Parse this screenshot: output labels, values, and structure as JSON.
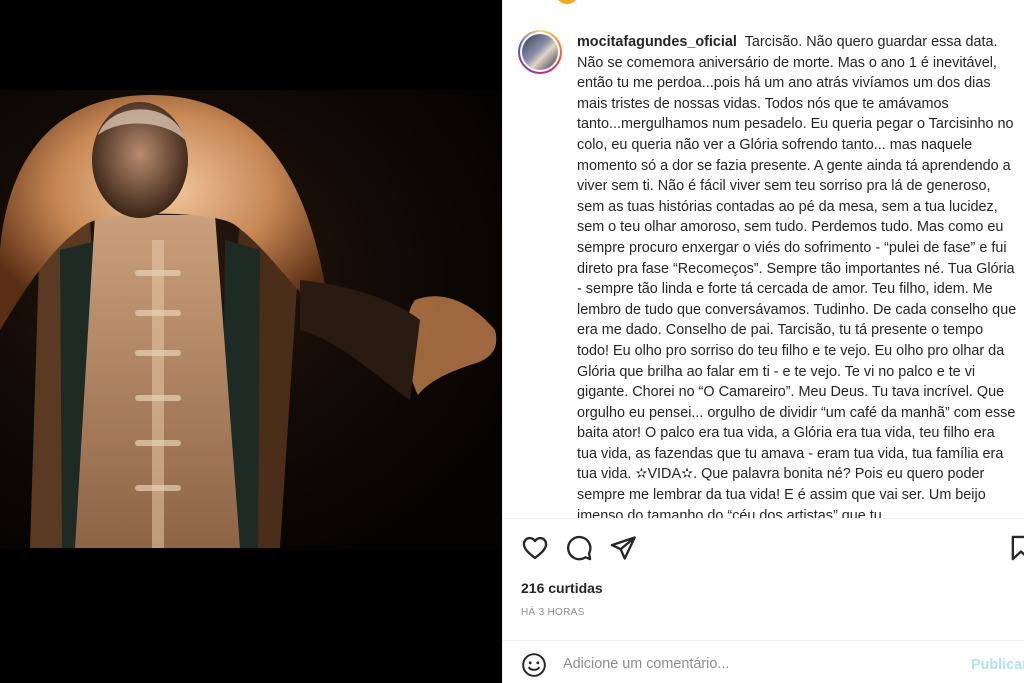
{
  "post": {
    "username": "mocitafagundes_oficial",
    "caption": "Tarcisão. Não quero guardar essa data. Não se comemora aniversário de morte. Mas o ano 1 é inevitável, então tu me perdoa...pois há um ano atrás vivíamos um dos dias mais tristes de nossas vidas. Todos nós que te amávamos tanto...mergulhamos num pesadelo. Eu queria pegar o Tarcisinho no colo, eu queria não ver a Glória sofrendo tanto... mas naquele momento só a dor se fazia presente. A gente ainda tá aprendendo a viver sem ti. Não é fácil viver sem teu sorriso pra lá de generoso, sem as tuas histórias contadas ao pé da mesa, sem a tua lucidez, sem o teu olhar amoroso, sem tudo. Perdemos tudo. Mas como eu sempre procuro enxergar o viés do sofrimento - “pulei de fase” e fui direto pra fase “Recomeços”. Sempre tão importantes né. Tua Glória - sempre tão linda e forte tá cercada de amor. Teu filho, idem. Me lembro de tudo que conversávamos. Tudinho. De cada conselho que era me dado. Conselho de pai. Tarcisão, tu tá presente o tempo todo! Eu olho pro sorriso do teu filho e te vejo. Eu olho pro olhar da Glória que brilha ao falar em ti - e te vejo. Te vi no palco e te vi gigante. Chorei no “O Camareiro”. Meu Deus. Tu tava incrível. Que orgulho eu pensei... orgulho de dividir “um café da manhã” com esse baita ator! O palco era tua vida, a Glória era tua vida, teu filho era tua vida, as fazendas que tu amava - eram tua vida, tua família era tua vida. ✫VIDA✫. Que palavra bonita né? Pois eu quero poder sempre me lembrar da tua vida! E é assim que vai ser. Um beijo imenso do tamanho do “céu dos artistas” que tu",
    "likes": "216 curtidas",
    "time": "HÁ 3 HORAS"
  },
  "actions": {
    "like_icon": "heart-icon",
    "comment_icon": "comment-icon",
    "share_icon": "paper-plane-icon",
    "save_icon": "bookmark-icon"
  },
  "comment": {
    "placeholder": "Adicione um comentário...",
    "publish_label": "Publicar",
    "emoji_icon": "smiley-icon"
  },
  "colors": {
    "text": "#262626",
    "muted": "#8e8e8e",
    "publish_disabled": "#b2dffc",
    "divider": "#efefef"
  }
}
